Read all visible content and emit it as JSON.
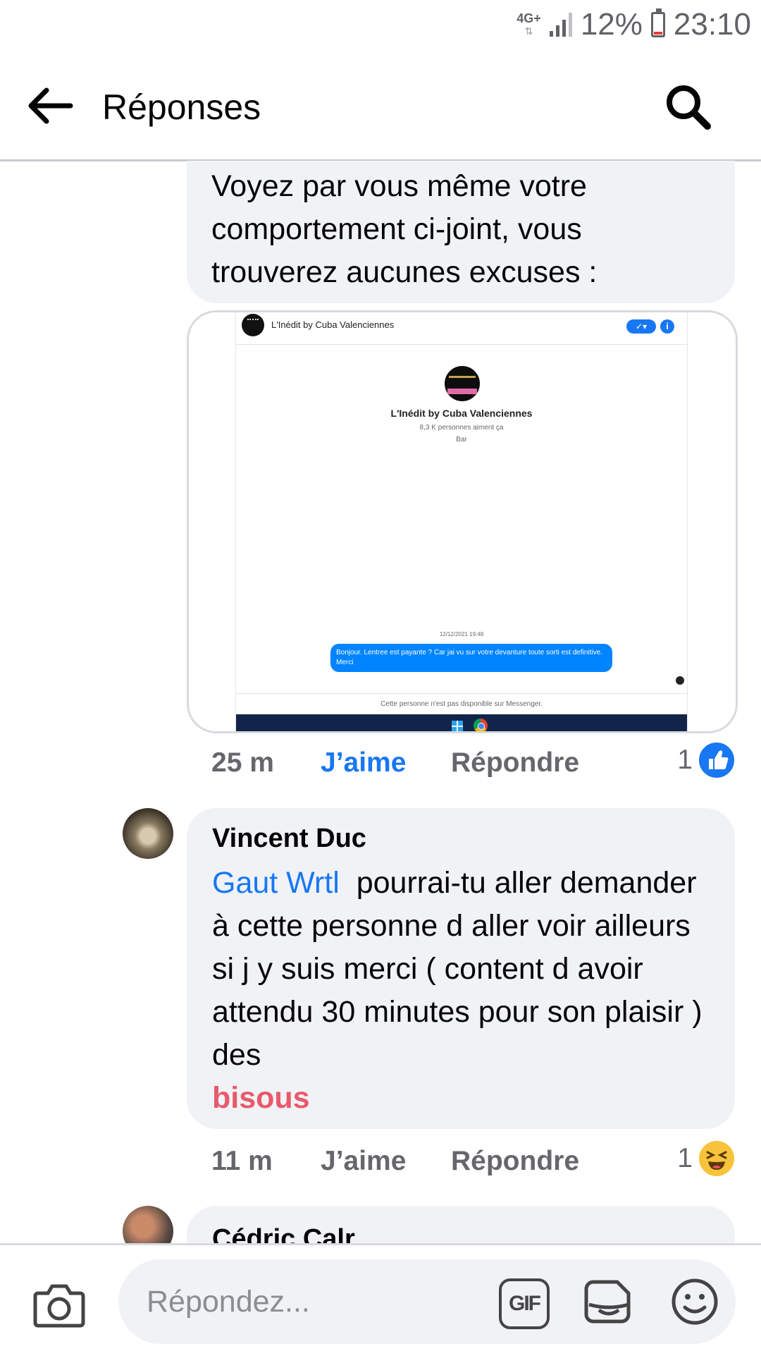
{
  "status_bar": {
    "network": "4G+",
    "battery": "12%",
    "time": "23:10"
  },
  "header": {
    "title": "Réponses",
    "back_icon": "arrow-left-icon",
    "search_icon": "search-icon"
  },
  "comments": [
    {
      "text": "Voyez par vous même votre comportement ci-joint, vous trouverez aucunes excuses :",
      "attachment": {
        "page_name": "L'Inédit by Cuba Valenciennes",
        "likes_text": "8,3 K personnes aiment ça",
        "category": "Bar",
        "date": "12/12/2021 19:48",
        "message": "Bonjour. Lentree est payante ? Car jai vu sur votre devanture toute sorti est definitive. Merci",
        "unavailable_text": "Cette personne n'est pas disponible sur Messenger."
      },
      "time": "25 m",
      "like_label": "J’aime",
      "reply_label": "Répondre",
      "reaction_count": "1",
      "reaction_icon": "like-reaction-icon"
    },
    {
      "author": "Vincent Duc",
      "mention": "Gaut Wrtl",
      "text": "pourrai-tu aller demander à cette personne d aller voir ailleurs si j y suis merci ( content d avoir attendu 30 minutes pour son plaisir ) des",
      "highlight": "bisous",
      "time": "11 m",
      "like_label": "J’aime",
      "reply_label": "Répondre",
      "reaction_count": "1",
      "reaction_icon": "haha-reaction-icon"
    },
    {
      "author": "Cédric Calr"
    }
  ],
  "composer": {
    "placeholder": "Répondez...",
    "gif_label": "GIF"
  },
  "colors": {
    "accent": "#1877f2",
    "bubble": "#f0f2f5",
    "highlight": "#e8596b"
  }
}
